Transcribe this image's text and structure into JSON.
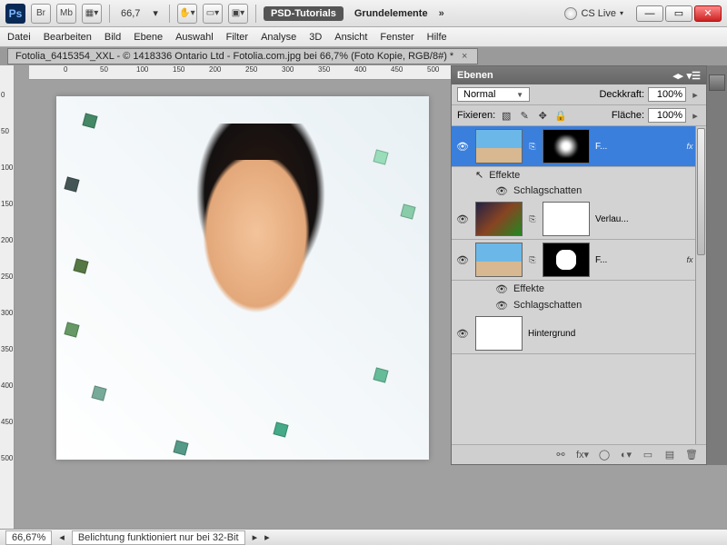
{
  "top": {
    "ps": "Ps",
    "br": "Br",
    "mb": "Mb",
    "zoom": "66,7",
    "workspace1": "PSD-Tutorials",
    "workspace2": "Grundelemente",
    "cslive": "CS Live"
  },
  "menus": [
    "Datei",
    "Bearbeiten",
    "Bild",
    "Ebene",
    "Auswahl",
    "Filter",
    "Analyse",
    "3D",
    "Ansicht",
    "Fenster",
    "Hilfe"
  ],
  "doc_tab": "Fotolia_6415354_XXL - © 1418336 Ontario Ltd - Fotolia.com.jpg bei 66,7% (Foto Kopie, RGB/8#) *",
  "ruler_h": [
    "0",
    "50",
    "100",
    "150",
    "200",
    "250",
    "300",
    "350",
    "400",
    "450",
    "500"
  ],
  "ruler_v": [
    "0",
    "50",
    "100",
    "150",
    "200",
    "250",
    "300",
    "350",
    "400",
    "450",
    "500"
  ],
  "panel": {
    "title": "Ebenen",
    "blend": "Normal",
    "opacity_label": "Deckkraft:",
    "opacity": "100%",
    "lock_label": "Fixieren:",
    "fill_label": "Fläche:",
    "fill": "100%"
  },
  "layers": [
    {
      "name": "F...",
      "fx": "fx",
      "effects_label": "Effekte",
      "shadow": "Schlagschatten"
    },
    {
      "name": "Verlau..."
    },
    {
      "name": "F...",
      "fx": "fx",
      "effects_label": "Effekte",
      "shadow": "Schlagschatten"
    },
    {
      "name": "Hintergrund"
    }
  ],
  "status": {
    "zoom": "66,67%",
    "msg": "Belichtung funktioniert nur bei 32-Bit"
  }
}
